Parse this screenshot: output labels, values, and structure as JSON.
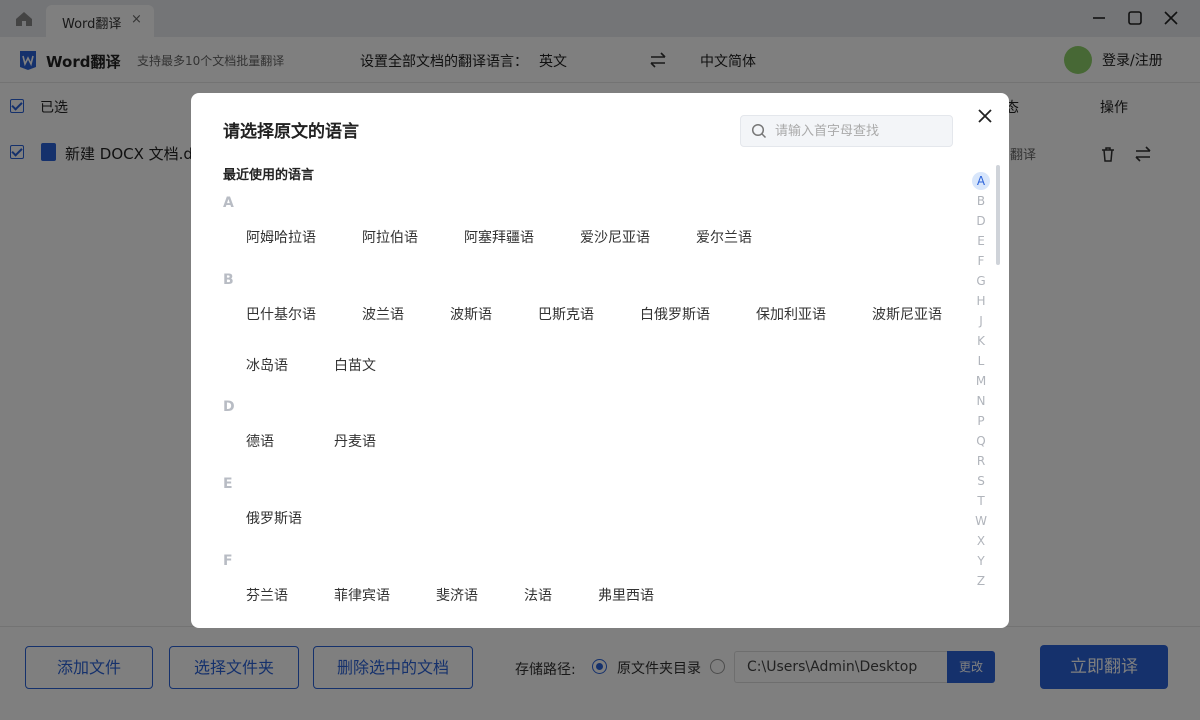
{
  "titlebar": {
    "tab_label": "Word翻译",
    "tab_close": "×"
  },
  "toolbar": {
    "app_name": "Word翻译",
    "app_sub": "支持最多10个文档批量翻译",
    "set_label": "设置全部文档的翻译语言：",
    "source_lang": "英文",
    "target_lang": "中文简体",
    "login": "登录/注册"
  },
  "table": {
    "col_selected": "已选",
    "col_status": "态",
    "col_action": "操作",
    "row": {
      "name": "新建 DOCX 文档.do",
      "status": "翻译"
    }
  },
  "bottom": {
    "add_file": "添加文件",
    "choose_folder": "选择文件夹",
    "delete_selected": "删除选中的文档",
    "storage_label": "存储路径:",
    "radio_original": "原文件夹目录",
    "path": "C:\\Users\\Admin\\Desktop",
    "change": "更改",
    "translate_now": "立即翻译"
  },
  "modal": {
    "title": "请选择原文的语言",
    "search_placeholder": "请输入首字母查找",
    "recent_label": "最近使用的语言",
    "groups": [
      {
        "letter": "A",
        "rows": [
          [
            "阿姆哈拉语",
            "阿拉伯语",
            "阿塞拜疆语",
            "爱沙尼亚语",
            "爱尔兰语"
          ]
        ]
      },
      {
        "letter": "B",
        "rows": [
          [
            "巴什基尔语",
            "波兰语",
            "波斯语",
            "巴斯克语",
            "白俄罗斯语",
            "保加利亚语",
            "波斯尼亚语"
          ],
          [
            "冰岛语",
            "白苗文"
          ]
        ]
      },
      {
        "letter": "D",
        "rows": [
          [
            "德语",
            "丹麦语"
          ]
        ]
      },
      {
        "letter": "E",
        "rows": [
          [
            "俄罗斯语"
          ]
        ]
      },
      {
        "letter": "F",
        "rows": [
          [
            "芬兰语",
            "菲律宾语",
            "斐济语",
            "法语",
            "弗里西语"
          ]
        ]
      }
    ],
    "alphabet": [
      "A",
      "B",
      "D",
      "E",
      "F",
      "G",
      "H",
      "J",
      "K",
      "L",
      "M",
      "N",
      "P",
      "Q",
      "R",
      "S",
      "T",
      "W",
      "X",
      "Y",
      "Z"
    ],
    "active_letter": "A"
  }
}
